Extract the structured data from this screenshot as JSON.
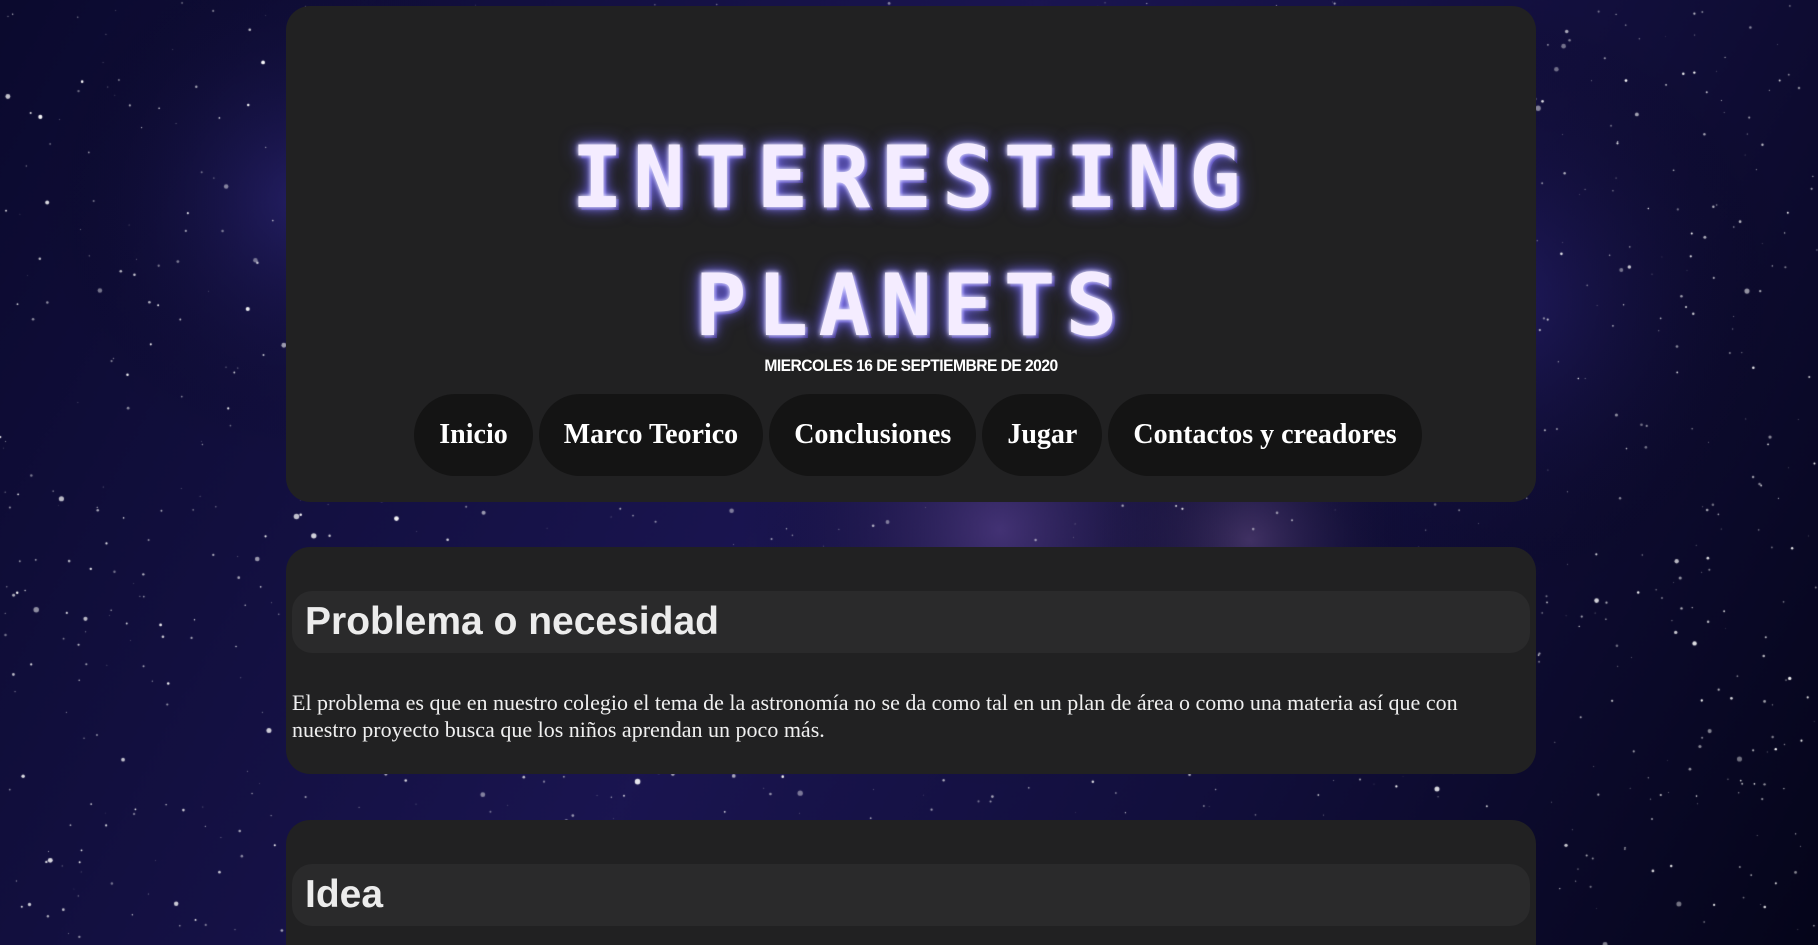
{
  "site": {
    "title_line1": "INTERESTING",
    "title_line2": "PLANETS",
    "date": "MIERCOLES 16 DE SEPTIEMBRE DE 2020"
  },
  "nav": {
    "items": [
      {
        "label": "Inicio"
      },
      {
        "label": "Marco Teorico"
      },
      {
        "label": "Conclusiones"
      },
      {
        "label": "Jugar"
      },
      {
        "label": "Contactos y creadores"
      }
    ]
  },
  "sections": [
    {
      "title": "Problema o necesidad",
      "body": "El problema es que en nuestro colegio el tema de la astronomía no se da como tal en un plan de área o como una materia así que con nuestro proyecto busca que los niños aprendan un poco más."
    },
    {
      "title": "Idea",
      "body": ""
    }
  ],
  "colors": {
    "background": "#07061c",
    "card": "#212122",
    "nav_pill": "#141414",
    "section_header": "#2a2a2b",
    "logo_glow": "#8f86ff"
  }
}
